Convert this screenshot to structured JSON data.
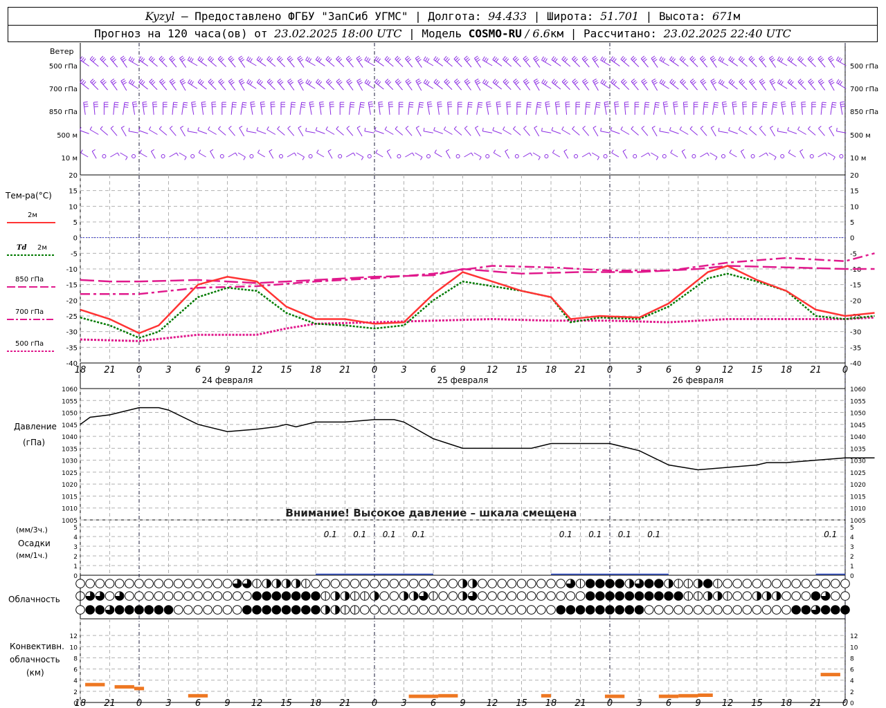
{
  "header": {
    "station": "Kyzyl",
    "provided": " – Предоставлено ФГБУ \"ЗапСиб УГМС\" | Долгота: ",
    "lon": "94.433",
    "lat_label": " | Широта: ",
    "lat": "51.701",
    "alt_label": " | Высота: ",
    "alt": "671",
    "alt_unit": "м",
    "forecast_label": "Прогноз на 120 часа(ов) от ",
    "forecast_from": "23.02.2025 18:00 UTC",
    "model_label": " | Модель ",
    "model": "COSMO-RU",
    "model_res": " / 6.6",
    "model_res_unit": "км",
    "computed_label": " | Рассчитано: ",
    "computed": "23.02.2025 22:40 UTC"
  },
  "labels": {
    "wind": "Ветер",
    "wind_levels": [
      "500 гПа",
      "700 гПа",
      "850 гПа",
      "500 м",
      "10 м"
    ],
    "temp_title": "Тем-ра(°C)",
    "t2m": "2м",
    "td_sym": "Td",
    "td_lvl": "2м",
    "t850": "850 гПа",
    "t700": "700 гПа",
    "t500": "500 гПа",
    "pressure": "Давление",
    "pressure_unit": "(гПа)",
    "pressure_warning": "Внимание! Высокое давление – шкала смещена",
    "precip_3h": "(мм/3ч.)",
    "precip": "Осадки",
    "precip_1h": "(мм/1ч.)",
    "clouds": "Облачность",
    "conv1": "Конвективн.",
    "conv2": "облачность",
    "conv3": "(км)",
    "dates": [
      "24 февраля",
      "25 февраля",
      "26 февраля"
    ]
  },
  "colors": {
    "wind": "#8a2be2",
    "t2m": "#ff3333",
    "td": "#007a00",
    "t850": "#e0198c",
    "t700": "#e0198c",
    "t500": "#e0198c",
    "zero_line": "#3333cc",
    "precip": "#1f3fbf",
    "conv": "#ee7722"
  },
  "chart_data": {
    "type": "meteogram",
    "hours": [
      0,
      3,
      6,
      9,
      12,
      15,
      18,
      21,
      24,
      27,
      30,
      33,
      36,
      39,
      42,
      45,
      48,
      51,
      54,
      57,
      60,
      63,
      66,
      69,
      72
    ],
    "time_ticks": [
      "18",
      "21",
      "0",
      "3",
      "6",
      "9",
      "12",
      "15",
      "18",
      "21",
      "0",
      "3",
      "6",
      "9",
      "12",
      "15",
      "18",
      "21",
      "0",
      "3",
      "6",
      "9",
      "12",
      "15",
      "18",
      "21",
      "0"
    ],
    "temperature": {
      "ylim": [
        -40,
        20
      ],
      "ticks": [
        "20",
        "15",
        "10",
        "5",
        "0",
        "-5",
        "-10",
        "-15",
        "-20",
        "-25",
        "-30",
        "-35",
        "-40"
      ],
      "t2m": [
        [
          0,
          -23
        ],
        [
          3,
          -26
        ],
        [
          6,
          -30.5
        ],
        [
          8,
          -28
        ],
        [
          12,
          -15
        ],
        [
          15,
          -12.5
        ],
        [
          18,
          -14
        ],
        [
          21,
          -22
        ],
        [
          24,
          -26
        ],
        [
          27,
          -26
        ],
        [
          30,
          -27.5
        ],
        [
          33,
          -27
        ],
        [
          36,
          -18
        ],
        [
          39,
          -11
        ],
        [
          42,
          -14
        ],
        [
          45,
          -17
        ],
        [
          48,
          -19
        ],
        [
          50,
          -26
        ],
        [
          53,
          -25
        ],
        [
          57,
          -25.5
        ],
        [
          60,
          -21
        ],
        [
          64,
          -11
        ],
        [
          66,
          -9
        ],
        [
          69,
          -13.5
        ],
        [
          72,
          -17
        ],
        [
          75,
          -23
        ],
        [
          78,
          -25
        ],
        [
          81,
          -24
        ]
      ],
      "td2m": [
        [
          0,
          -25.5
        ],
        [
          3,
          -28
        ],
        [
          6,
          -32
        ],
        [
          8,
          -30
        ],
        [
          12,
          -19
        ],
        [
          15,
          -16
        ],
        [
          18,
          -17
        ],
        [
          21,
          -24
        ],
        [
          24,
          -27.5
        ],
        [
          27,
          -28
        ],
        [
          30,
          -29
        ],
        [
          33,
          -28
        ],
        [
          36,
          -20
        ],
        [
          39,
          -14
        ],
        [
          42,
          -15.5
        ],
        [
          45,
          -17
        ],
        [
          48,
          -19
        ],
        [
          50,
          -27
        ],
        [
          53,
          -25.5
        ],
        [
          57,
          -26
        ],
        [
          60,
          -22
        ],
        [
          64,
          -13
        ],
        [
          66,
          -11.5
        ],
        [
          69,
          -14
        ],
        [
          72,
          -17
        ],
        [
          75,
          -25
        ],
        [
          78,
          -26
        ],
        [
          81,
          -25
        ]
      ],
      "t850": [
        [
          0,
          -13.5
        ],
        [
          3,
          -14
        ],
        [
          6,
          -14
        ],
        [
          12,
          -13.5
        ],
        [
          18,
          -14.5
        ],
        [
          24,
          -13.5
        ],
        [
          30,
          -12.5
        ],
        [
          36,
          -12
        ],
        [
          39,
          -10
        ],
        [
          45,
          -11.5
        ],
        [
          51,
          -11
        ],
        [
          57,
          -11
        ],
        [
          63,
          -10
        ],
        [
          66,
          -9
        ],
        [
          72,
          -9.5
        ],
        [
          78,
          -10
        ],
        [
          81,
          -10
        ]
      ],
      "t700": [
        [
          0,
          -18
        ],
        [
          3,
          -18
        ],
        [
          6,
          -18
        ],
        [
          12,
          -16
        ],
        [
          18,
          -15.5
        ],
        [
          24,
          -14
        ],
        [
          30,
          -13
        ],
        [
          36,
          -11.5
        ],
        [
          42,
          -9
        ],
        [
          48,
          -9.5
        ],
        [
          54,
          -10.5
        ],
        [
          60,
          -10.5
        ],
        [
          66,
          -8
        ],
        [
          72,
          -6.5
        ],
        [
          78,
          -7.5
        ],
        [
          81,
          -5
        ]
      ],
      "t500": [
        [
          0,
          -32.5
        ],
        [
          6,
          -33
        ],
        [
          9,
          -32
        ],
        [
          12,
          -31
        ],
        [
          18,
          -31
        ],
        [
          21,
          -29
        ],
        [
          24,
          -27.5
        ],
        [
          30,
          -27
        ],
        [
          36,
          -26.5
        ],
        [
          42,
          -26
        ],
        [
          48,
          -26.5
        ],
        [
          54,
          -26.5
        ],
        [
          60,
          -27
        ],
        [
          66,
          -26
        ],
        [
          72,
          -26
        ],
        [
          78,
          -26
        ],
        [
          81,
          -25.5
        ]
      ]
    },
    "pressure": {
      "ylim": [
        1005,
        1060
      ],
      "ticks": [
        "1060",
        "1055",
        "1050",
        "1045",
        "1040",
        "1035",
        "1030",
        "1025",
        "1020",
        "1015",
        "1010",
        "1005"
      ],
      "values": [
        [
          0,
          1045
        ],
        [
          1,
          1048
        ],
        [
          3,
          1049
        ],
        [
          6,
          1052
        ],
        [
          8,
          1052
        ],
        [
          9,
          1051
        ],
        [
          12,
          1045
        ],
        [
          15,
          1042
        ],
        [
          18,
          1043
        ],
        [
          20,
          1044
        ],
        [
          21,
          1045
        ],
        [
          22,
          1044
        ],
        [
          24,
          1046
        ],
        [
          27,
          1046
        ],
        [
          30,
          1047
        ],
        [
          32,
          1047
        ],
        [
          33,
          1046
        ],
        [
          36,
          1039
        ],
        [
          39,
          1035
        ],
        [
          42,
          1035
        ],
        [
          45,
          1035
        ],
        [
          46,
          1035
        ],
        [
          48,
          1037
        ],
        [
          49,
          1037
        ],
        [
          51,
          1037
        ],
        [
          54,
          1037
        ],
        [
          57,
          1034
        ],
        [
          60,
          1028
        ],
        [
          63,
          1026
        ],
        [
          66,
          1027
        ],
        [
          69,
          1028
        ],
        [
          70,
          1029
        ],
        [
          72,
          1029
        ],
        [
          75,
          1030
        ],
        [
          78,
          1031
        ],
        [
          81,
          1031
        ]
      ]
    },
    "precipitation": {
      "ylim": [
        0,
        5
      ],
      "ticks": [
        "5",
        "4",
        "3",
        "2",
        "1",
        "0"
      ],
      "labels_3h": [
        {
          "t": 25.5,
          "v": "0.1"
        },
        {
          "t": 28.5,
          "v": "0.1"
        },
        {
          "t": 31.5,
          "v": "0.1"
        },
        {
          "t": 34.5,
          "v": "0.1"
        },
        {
          "t": 49.5,
          "v": "0.1"
        },
        {
          "t": 52.5,
          "v": "0.1"
        },
        {
          "t": 55.5,
          "v": "0.1"
        },
        {
          "t": 58.5,
          "v": "0.1"
        },
        {
          "t": 76.5,
          "v": "0.1"
        }
      ]
    },
    "cloud_rows": [
      "0000000000000000331222210000000000000002200000000031444423442112410000000000000",
      "1330300000000000004444444122112002231002300000000000444444444411221002220004300",
      "0443444444000000044444444221100000000000000000000444444444000000000000000443444"
    ],
    "convective": {
      "ylim": [
        0,
        14
      ],
      "ticks": [
        "12",
        "10",
        "8",
        "6",
        "4",
        "2",
        "0"
      ],
      "bars": [
        [
          0.5,
          2.5,
          3.2
        ],
        [
          3.5,
          5.5,
          2.8
        ],
        [
          5.5,
          6.5,
          2.5
        ],
        [
          11,
          13,
          1.2
        ],
        [
          33.5,
          36.5,
          1.1
        ],
        [
          36.5,
          38.5,
          1.2
        ],
        [
          47,
          48,
          1.2
        ],
        [
          53.5,
          55.5,
          1.1
        ],
        [
          59,
          61,
          1.1
        ],
        [
          61,
          63,
          1.2
        ],
        [
          63,
          64.5,
          1.3
        ],
        [
          75.5,
          77.5,
          5
        ]
      ]
    }
  }
}
